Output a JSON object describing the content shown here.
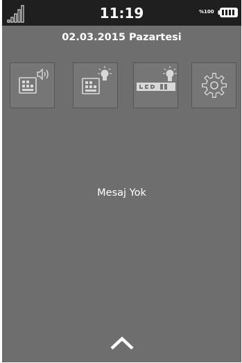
{
  "status_bar": {
    "time": "11:19",
    "battery_percent": "%100",
    "signal_icon": "signal-bars-icon",
    "battery_icon": "battery-full-icon"
  },
  "date_line": "02.03.2015 Pazartesi",
  "quick_settings": [
    {
      "name": "keypad-sound",
      "icon": "keypad-speaker-icon"
    },
    {
      "name": "keypad-backlight",
      "icon": "keypad-bulb-icon"
    },
    {
      "name": "lcd-backlight",
      "icon": "lcd-bulb-icon"
    },
    {
      "name": "settings",
      "icon": "gear-icon"
    }
  ],
  "messages": {
    "empty_text": "Mesaj Yok"
  },
  "expand_icon": "chevron-up-icon",
  "colors": {
    "background": "#6e6e6e",
    "status_bar": "#1f1f1f",
    "text": "#ffffff",
    "icon": "#d8d8d8"
  }
}
